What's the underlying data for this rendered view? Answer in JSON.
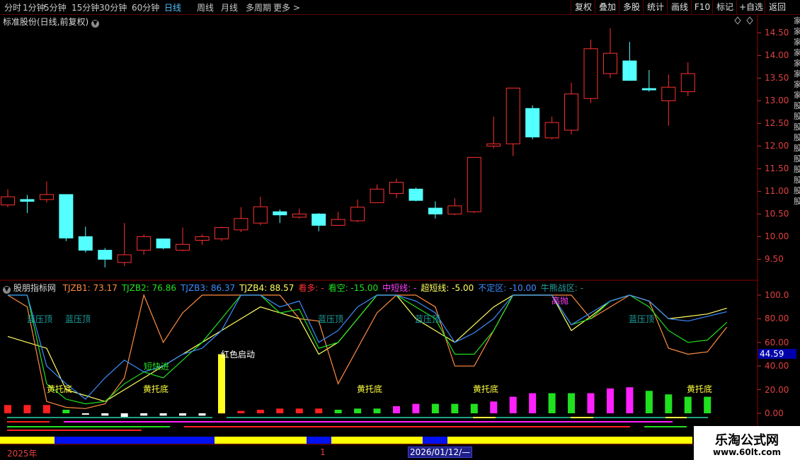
{
  "toolbar": {
    "periods": [
      "分时",
      "1分钟",
      "5分钟",
      "15分钟",
      "30分钟",
      "60分钟",
      "日线",
      "周线",
      "月线",
      "多周期",
      "更多 >"
    ],
    "active": "日线",
    "actions": [
      "复权",
      "叠加",
      "多股",
      "统计",
      "画线",
      "F10",
      "标记",
      "+自选",
      "返回"
    ]
  },
  "stock": {
    "title": "标准股份(日线,前复权)"
  },
  "price_axis": [
    "14.50",
    "14.00",
    "13.50",
    "13.00",
    "12.50",
    "12.00",
    "11.50",
    "11.00",
    "10.50",
    "10.00",
    "9.50"
  ],
  "indicator": {
    "name": "股朋指标网",
    "fields": [
      {
        "label": "TJZB1: 73.17",
        "color": "#ff8c40"
      },
      {
        "label": "TJZB2: 76.86",
        "color": "#20e020"
      },
      {
        "label": "TJZB3: 86.37",
        "color": "#3a8cff"
      },
      {
        "label": "TJZB4: 88.57",
        "color": "#ffff60"
      },
      {
        "label": "看多: -",
        "color": "#ff3030"
      },
      {
        "label": "看空: -15.00",
        "color": "#20e020"
      },
      {
        "label": "中短线: -",
        "color": "#ff40ff"
      },
      {
        "label": "超短线: -5.00",
        "color": "#ffff60"
      },
      {
        "label": "不定区: -10.00",
        "color": "#3a8cff"
      },
      {
        "label": "牛熊战区: -",
        "color": "#20a0a0"
      }
    ],
    "axis": [
      "100.0",
      "80.00",
      "60.00",
      "40.00",
      "20.00",
      "0.00"
    ],
    "current": "44.59",
    "signals": {
      "lanya": "蓝压顶",
      "huangtuo": "黄托底",
      "duankuaijin": "短快进",
      "hongse": "红色启动",
      "gaopao": "高抛"
    }
  },
  "timeline": {
    "year": "2025年",
    "mark": "1",
    "date": "2026/01/12/—"
  },
  "watermark": {
    "line1": "乐淘公式网",
    "line2": "www.60lt.com"
  },
  "right_strip": "家家家家家家家家股股股股股股股股股股",
  "chart_data": {
    "type": "candlestick",
    "title": "标准股份(日线,前复权)",
    "ylim": [
      9.1,
      14.85
    ],
    "candles": [
      {
        "o": 10.7,
        "c": 10.88,
        "h": 11.05,
        "l": 10.65
      },
      {
        "o": 10.82,
        "c": 10.78,
        "h": 10.92,
        "l": 10.52
      },
      {
        "o": 10.82,
        "c": 10.93,
        "h": 11.22,
        "l": 10.75
      },
      {
        "o": 10.93,
        "c": 9.97,
        "h": 10.93,
        "l": 9.9
      },
      {
        "o": 10.0,
        "c": 9.7,
        "h": 10.22,
        "l": 9.65
      },
      {
        "o": 9.7,
        "c": 9.5,
        "h": 9.75,
        "l": 9.32
      },
      {
        "o": 9.43,
        "c": 9.6,
        "h": 10.3,
        "l": 9.35
      },
      {
        "o": 9.7,
        "c": 10.0,
        "h": 10.05,
        "l": 9.6
      },
      {
        "o": 9.95,
        "c": 9.75,
        "h": 9.95,
        "l": 9.72
      },
      {
        "o": 9.7,
        "c": 9.83,
        "h": 10.2,
        "l": 9.68
      },
      {
        "o": 9.92,
        "c": 10.0,
        "h": 10.05,
        "l": 9.82
      },
      {
        "o": 9.95,
        "c": 10.2,
        "h": 10.22,
        "l": 9.9
      },
      {
        "o": 10.15,
        "c": 10.4,
        "h": 10.65,
        "l": 10.1
      },
      {
        "o": 10.3,
        "c": 10.66,
        "h": 10.88,
        "l": 10.25
      },
      {
        "o": 10.55,
        "c": 10.48,
        "h": 10.6,
        "l": 10.3
      },
      {
        "o": 10.43,
        "c": 10.5,
        "h": 10.62,
        "l": 10.4
      },
      {
        "o": 10.5,
        "c": 10.25,
        "h": 10.52,
        "l": 10.12
      },
      {
        "o": 10.25,
        "c": 10.38,
        "h": 10.55,
        "l": 10.25
      },
      {
        "o": 10.35,
        "c": 10.65,
        "h": 10.82,
        "l": 10.32
      },
      {
        "o": 10.75,
        "c": 11.05,
        "h": 11.15,
        "l": 10.75
      },
      {
        "o": 10.95,
        "c": 11.2,
        "h": 11.28,
        "l": 10.85
      },
      {
        "o": 11.05,
        "c": 10.8,
        "h": 11.08,
        "l": 10.78
      },
      {
        "o": 10.63,
        "c": 10.5,
        "h": 10.78,
        "l": 10.4
      },
      {
        "o": 10.5,
        "c": 10.68,
        "h": 10.85,
        "l": 10.48
      },
      {
        "o": 10.55,
        "c": 11.75,
        "h": 11.75,
        "l": 10.52
      },
      {
        "o": 12.0,
        "c": 12.05,
        "h": 12.65,
        "l": 11.95
      },
      {
        "o": 12.05,
        "c": 13.28,
        "h": 13.28,
        "l": 11.78
      },
      {
        "o": 12.83,
        "c": 12.2,
        "h": 12.9,
        "l": 12.15
      },
      {
        "o": 12.18,
        "c": 12.52,
        "h": 12.65,
        "l": 12.15
      },
      {
        "o": 12.35,
        "c": 13.15,
        "h": 13.4,
        "l": 12.25
      },
      {
        "o": 13.05,
        "c": 14.15,
        "h": 14.35,
        "l": 12.95
      },
      {
        "o": 13.6,
        "c": 14.05,
        "h": 14.6,
        "l": 13.5
      },
      {
        "o": 13.88,
        "c": 13.45,
        "h": 14.3,
        "l": 13.45
      },
      {
        "o": 13.27,
        "c": 13.24,
        "h": 13.68,
        "l": 13.2
      },
      {
        "o": 13.0,
        "c": 13.3,
        "h": 13.58,
        "l": 12.45
      },
      {
        "o": 13.2,
        "c": 13.6,
        "h": 13.85,
        "l": 13.1
      }
    ],
    "indicator_series": {
      "TJZB1": [
        100,
        90,
        10,
        5,
        4,
        8,
        30,
        100,
        60,
        85,
        100,
        100,
        100,
        100,
        100,
        80,
        78,
        25,
        55,
        85,
        100,
        100,
        90,
        40,
        40,
        70,
        100,
        100,
        100,
        100,
        80,
        90,
        100,
        95,
        55,
        50,
        52,
        73
      ],
      "TJZB2": [
        100,
        100,
        25,
        12,
        8,
        10,
        25,
        35,
        30,
        45,
        60,
        80,
        100,
        100,
        85,
        88,
        55,
        60,
        80,
        100,
        100,
        90,
        80,
        50,
        50,
        70,
        100,
        100,
        100,
        75,
        80,
        95,
        100,
        90,
        70,
        60,
        62,
        77
      ],
      "TJZB3": [
        100,
        100,
        40,
        25,
        12,
        30,
        45,
        35,
        40,
        50,
        55,
        70,
        100,
        100,
        90,
        95,
        60,
        70,
        90,
        100,
        100,
        95,
        85,
        60,
        68,
        80,
        100,
        100,
        100,
        75,
        85,
        95,
        100,
        95,
        80,
        78,
        82,
        86
      ],
      "TJZB4": [
        65,
        60,
        55,
        20,
        15,
        10,
        20,
        30,
        40,
        50,
        60,
        70,
        80,
        90,
        85,
        80,
        50,
        60,
        80,
        100,
        100,
        80,
        70,
        60,
        75,
        90,
        100,
        100,
        100,
        70,
        82,
        95,
        100,
        95,
        80,
        82,
        84,
        89
      ],
      "bars": [
        7,
        7,
        7,
        3,
        -1,
        -2,
        -4,
        -2,
        -2,
        -2,
        -2,
        1,
        2,
        3,
        4,
        4,
        4,
        3,
        4,
        4,
        6,
        8,
        8,
        8,
        8,
        10,
        14,
        17,
        17,
        17,
        17,
        21,
        22,
        19,
        16,
        14,
        14
      ],
      "bar_colors": [
        "r",
        "r",
        "r",
        "g",
        "w",
        "w",
        "w",
        "w",
        "w",
        "w",
        "w",
        "r",
        "r",
        "r",
        "r",
        "r",
        "r",
        "g",
        "g",
        "g",
        "m",
        "m",
        "g",
        "g",
        "g",
        "m",
        "m",
        "m",
        "g",
        "g",
        "m",
        "m",
        "m",
        "g",
        "g",
        "g",
        "g"
      ]
    }
  }
}
